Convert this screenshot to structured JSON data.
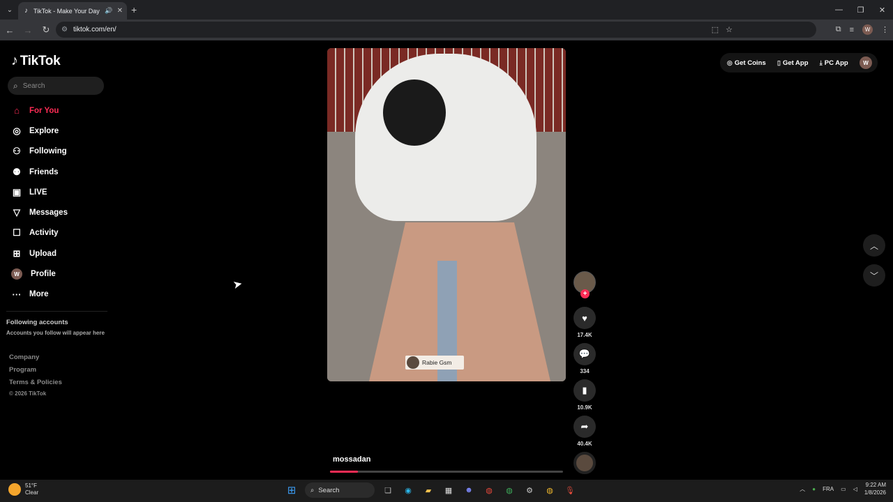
{
  "browser": {
    "tab_title": "TikTok - Make Your Day",
    "url": "tiktok.com/en/",
    "profile_initial": "W"
  },
  "tiktok": {
    "logo_text": "TikTok",
    "search_placeholder": "Search",
    "nav": [
      {
        "label": "For You",
        "icon": "home-icon",
        "active": true
      },
      {
        "label": "Explore",
        "icon": "compass-icon"
      },
      {
        "label": "Following",
        "icon": "person-icon"
      },
      {
        "label": "Friends",
        "icon": "people-icon"
      },
      {
        "label": "LIVE",
        "icon": "live-icon"
      },
      {
        "label": "Messages",
        "icon": "send-icon"
      },
      {
        "label": "Activity",
        "icon": "activity-icon"
      },
      {
        "label": "Upload",
        "icon": "plus-square-icon"
      },
      {
        "label": "Profile",
        "icon": "avatar"
      },
      {
        "label": "More",
        "icon": "more-icon"
      }
    ],
    "profile_initial": "W",
    "following_accounts_title": "Following accounts",
    "following_accounts_subtitle": "Accounts you follow will appear here",
    "footer": [
      "Company",
      "Program",
      "Terms & Policies"
    ],
    "copyright": "© 2026 TikTok",
    "top_actions": {
      "get_coins": "Get Coins",
      "get_app": "Get App",
      "pc_app": "PC App"
    },
    "video": {
      "overlay_label": "Rabie Gsm",
      "author": "mossadan",
      "progress": 0.12
    },
    "actions": {
      "likes": "17.4K",
      "comments": "334",
      "saves": "10.9K",
      "shares": "40.4K"
    }
  },
  "taskbar": {
    "temperature": "51°F",
    "condition": "Clear",
    "search_label": "Search",
    "language": "FRA",
    "time": "9:22 AM",
    "date": "1/8/2026"
  }
}
